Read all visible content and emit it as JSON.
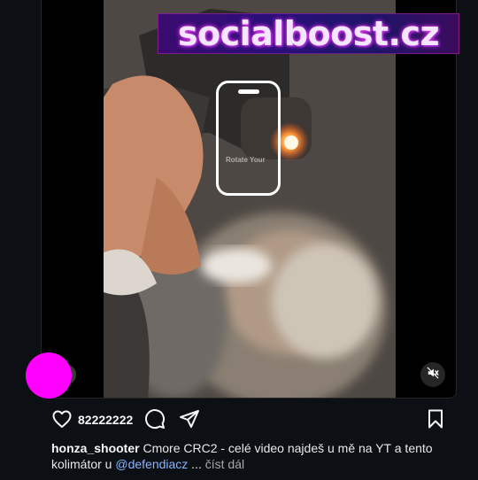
{
  "banner": {
    "text": "socialboost.cz"
  },
  "video_overlay": {
    "rotate_hint": "Rotate Your"
  },
  "actions": {
    "like_count": "82222222",
    "icons": [
      "heart-icon",
      "comment-icon",
      "share-icon",
      "bookmark-icon"
    ]
  },
  "caption": {
    "username": "honza_shooter",
    "text_before": "Cmore CRC2 - celé video najdeš u mě na YT a tento kolimátor u ",
    "mention": "@defendiacz",
    "ellipsis": " ...",
    "more_label": "číst dál"
  },
  "colors": {
    "background": "#0c1014",
    "avatar": "#ff00ff",
    "mention": "#8ab4ff",
    "banner_glow": "#ff3df2"
  }
}
